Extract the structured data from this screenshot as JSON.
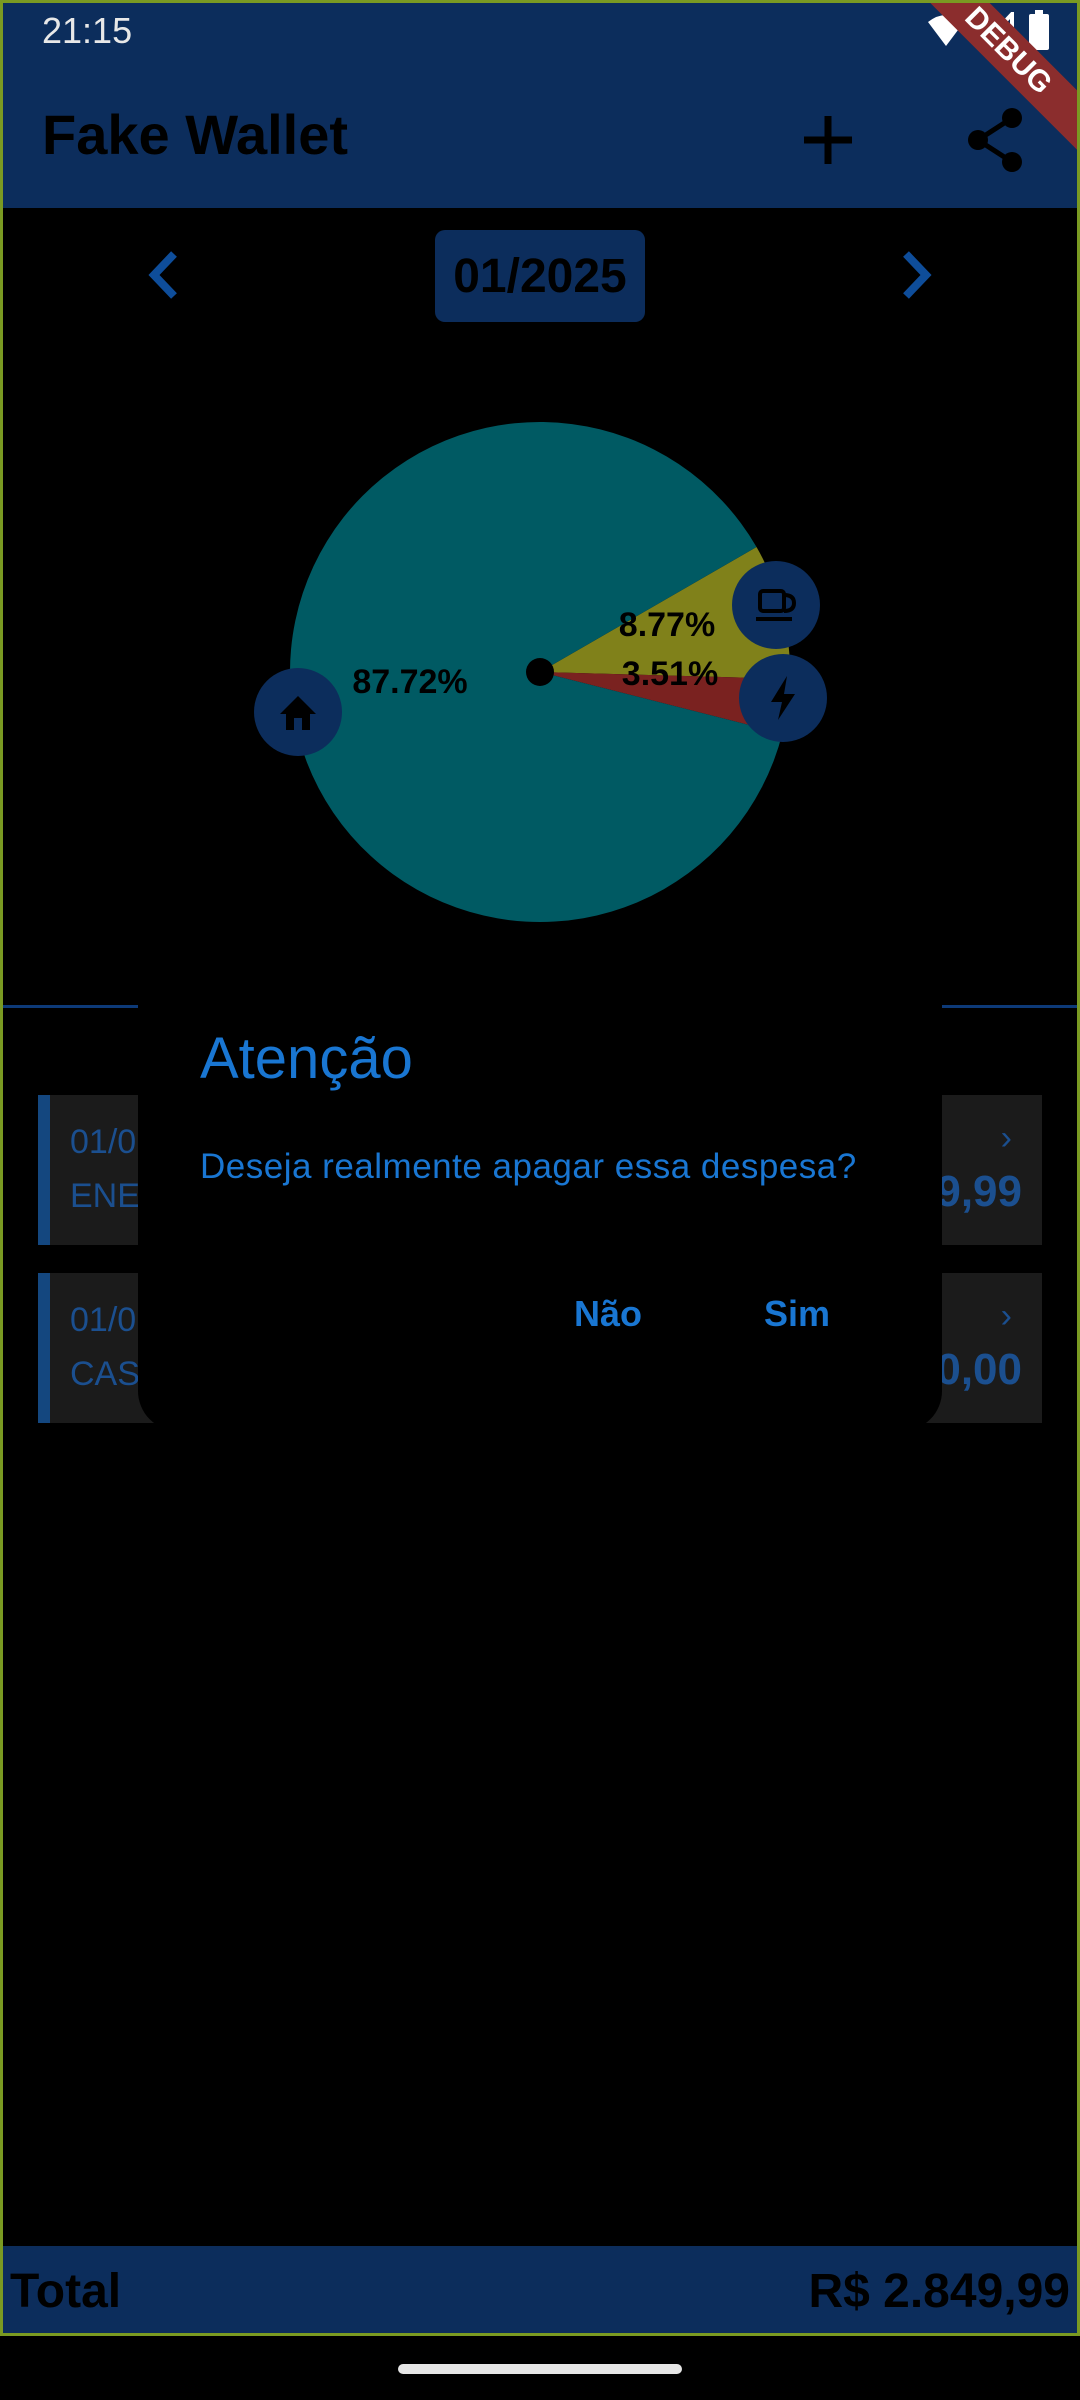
{
  "status_bar": {
    "time": "21:15",
    "icons": [
      "wifi-icon",
      "signal-icon",
      "battery-icon"
    ]
  },
  "debug_banner": "DEBUG",
  "app_bar": {
    "title": "Fake Wallet",
    "actions": [
      "add-icon",
      "share-icon"
    ]
  },
  "month_selector": {
    "current": "01/2025",
    "prev_icon": "chevron-left-icon",
    "next_icon": "chevron-right-icon"
  },
  "chart_data": {
    "type": "pie",
    "slices": [
      {
        "label": "87.72%",
        "value": 87.72,
        "color": "#005a63",
        "icon": "home-icon"
      },
      {
        "label": "8.77%",
        "value": 8.77,
        "color": "#80811a",
        "icon": "coffee-icon"
      },
      {
        "label": "3.51%",
        "value": 3.51,
        "color": "#7a2220",
        "icon": "bolt-icon"
      }
    ]
  },
  "expenses": [
    {
      "date": "01/0",
      "name": "ENE",
      "value": "9,99"
    },
    {
      "date": "01/0",
      "name": "CAS",
      "value": "0,00"
    }
  ],
  "dialog": {
    "title": "Atenção",
    "message": "Deseja realmente apagar essa despesa?",
    "cancel": "Não",
    "confirm": "Sim"
  },
  "total": {
    "label": "Total",
    "value": "R$ 2.849,99"
  },
  "colors": {
    "primary": "#0c2d5c",
    "accent": "#1976d2"
  }
}
